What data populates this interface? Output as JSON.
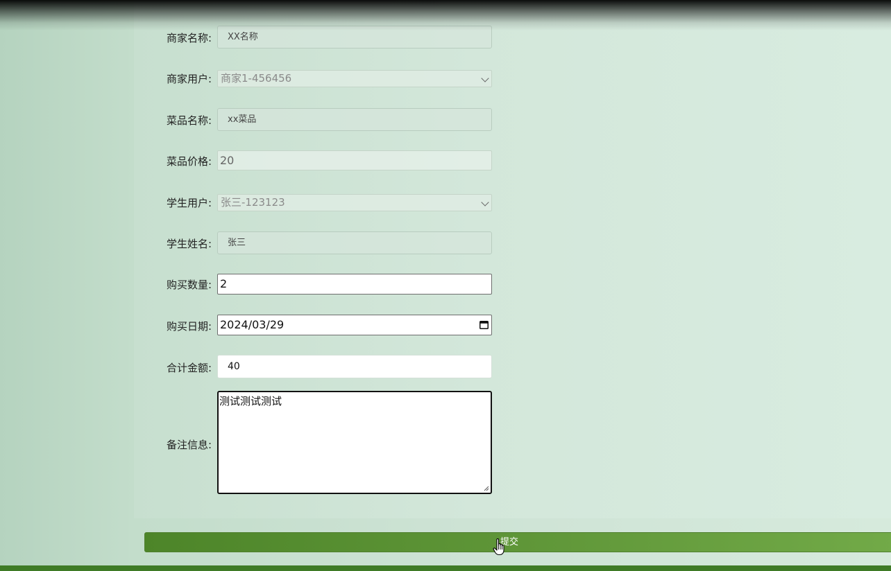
{
  "form": {
    "merchant_name": {
      "label": "商家名称:",
      "value": "XX名称"
    },
    "merchant_user": {
      "label": "商家用户:",
      "value": "商家1-456456"
    },
    "dish_name": {
      "label": "菜品名称:",
      "value": "xx菜品"
    },
    "dish_price": {
      "label": "菜品价格:",
      "value": "20"
    },
    "student_user": {
      "label": "学生用户:",
      "value": "张三-123123"
    },
    "student_name": {
      "label": "学生姓名:",
      "value": "张三"
    },
    "quantity": {
      "label": "购买数量:",
      "value": "2"
    },
    "purchase_date": {
      "label": "购买日期:",
      "value": "2024/03/29"
    },
    "total_amount": {
      "label": "合计金额:",
      "value": "40"
    },
    "remarks": {
      "label": "备注信息:",
      "value": "测试测试测试"
    }
  },
  "submit_label": "提交",
  "icons": {
    "select_arrow": "chevron-down-icon",
    "date_picker": "calendar-icon",
    "cursor": "hand-pointer-icon"
  },
  "colors": {
    "submit_button": "#5f9638",
    "bottom_bar": "#3f7b26",
    "page_background": "#cfe4d6"
  }
}
